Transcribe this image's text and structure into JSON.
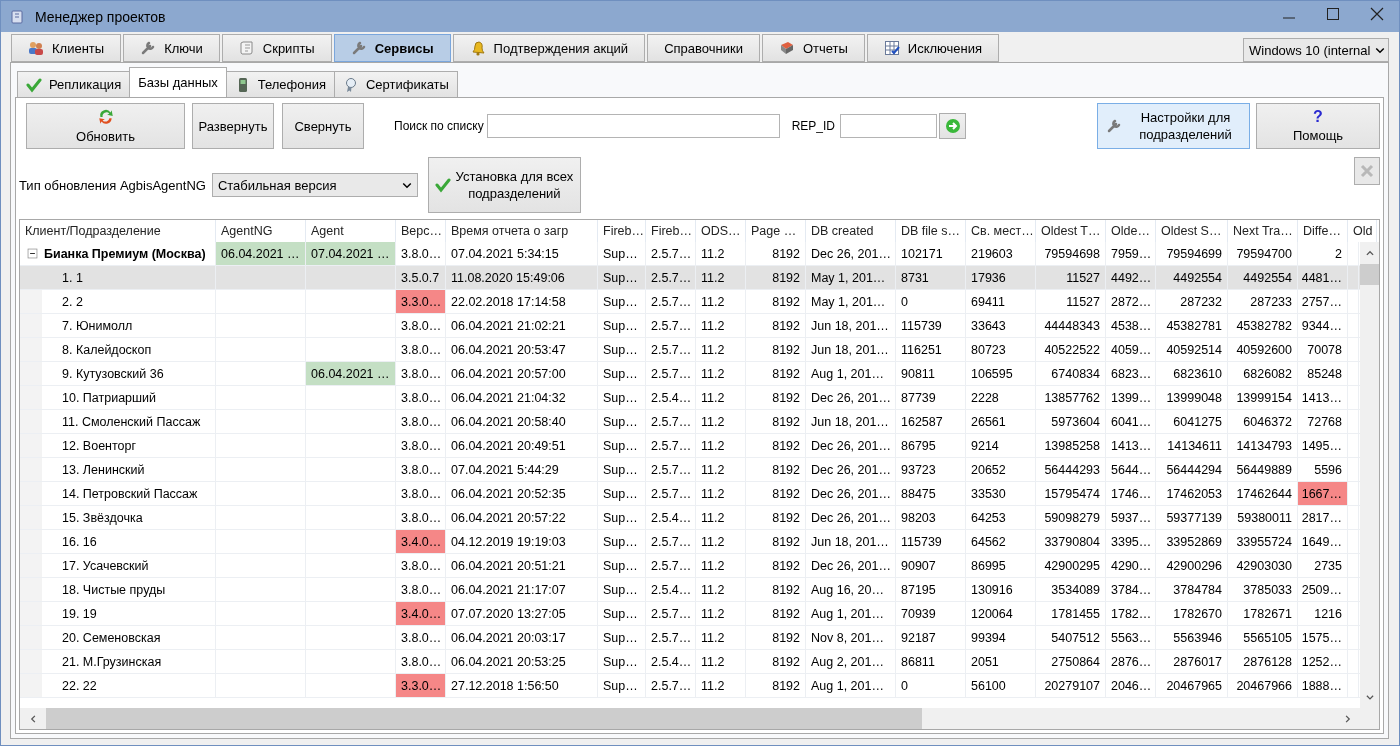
{
  "window": {
    "title": "Менеджер проектов"
  },
  "tabs": [
    {
      "label": "Клиенты",
      "selected": false
    },
    {
      "label": "Ключи",
      "selected": false
    },
    {
      "label": "Скрипты",
      "selected": false
    },
    {
      "label": "Сервисы",
      "selected": true
    },
    {
      "label": "Подтверждения акций",
      "selected": false
    },
    {
      "label": "Справочники",
      "selected": false
    },
    {
      "label": "Отчеты",
      "selected": false
    },
    {
      "label": "Исключения",
      "selected": false
    }
  ],
  "system_select": {
    "value": "Windows 10 (internal"
  },
  "subtabs": [
    {
      "label": "Репликация",
      "selected": false
    },
    {
      "label": "Базы данных",
      "selected": true
    },
    {
      "label": "Телефония",
      "selected": false
    },
    {
      "label": "Сертификаты",
      "selected": false
    }
  ],
  "toolbar": {
    "refresh": "Обновить",
    "expand": "Развернуть",
    "collapse": "Свернуть",
    "search_label": "Поиск по списку",
    "rep_id_label": "REP_ID",
    "settings": "Настройки для подразделений",
    "help": {
      "icon": "?",
      "label": "Помощь"
    },
    "clear_button": {
      "disabled": true
    }
  },
  "update": {
    "label": "Тип обновления AgbisAgentNG",
    "value": "Стабильная версия",
    "install_button": "Установка для всех подразделений"
  },
  "grid": {
    "columns": [
      "Клиент/Подразделение",
      "AgentNG",
      "Agent",
      "Верс…",
      "Время отчета о загр",
      "Fireb…",
      "Fireb…",
      "ODS…",
      "Page …",
      "DB created",
      "DB file s…",
      "Св. мест…",
      "Oldest T…",
      "Olde…",
      "Oldest S…",
      "Next Tra…",
      "Diffe…",
      "Old"
    ],
    "rows": [
      {
        "selected": false,
        "expanded": true,
        "cells": [
          "Бианка Премиум (Москва)",
          {
            "text": "06.04.2021 …",
            "color": "#c4dfc4"
          },
          {
            "text": "07.04.2021 …",
            "color": "#c4dfc4"
          },
          "3.8.0…",
          "07.04.2021 5:34:15",
          "Sup…",
          "2.5.7…",
          "11.2",
          "8192",
          "Dec 26, 201…",
          "102171",
          "219603",
          "79594698",
          "7959…",
          "79594699",
          "79594700",
          "2",
          ""
        ],
        "children": [
          {
            "selected": true,
            "cells": [
              "1. 1",
              "",
              "",
              "3.5.0.7",
              "11.08.2020 15:49:06",
              "Sup…",
              "2.5.7…",
              "11.2",
              "8192",
              "May 1, 201…",
              "8731",
              "17936",
              "11527",
              "4492…",
              "4492554",
              "4492554",
              "4481…",
              ""
            ]
          },
          {
            "selected": false,
            "cells": [
              "2. 2",
              "",
              "",
              {
                "text": "3.3.0…",
                "color": "#f58787"
              },
              "22.02.2018 17:14:58",
              "Sup…",
              "2.5.7…",
              "11.2",
              "8192",
              "May 1, 201…",
              "0",
              "69411",
              "11527",
              "2872…",
              "287232",
              "287233",
              "2757…",
              ""
            ]
          },
          {
            "selected": false,
            "cells": [
              "7. Юнимолл",
              "",
              "",
              "3.8.0…",
              "06.04.2021 21:02:21",
              "Sup…",
              "2.5.7…",
              "11.2",
              "8192",
              "Jun 18, 201…",
              "115739",
              "33643",
              "44448343",
              "4538…",
              "45382781",
              "45382782",
              "9344…",
              ""
            ]
          },
          {
            "selected": false,
            "cells": [
              "8. Калейдоскоп",
              "",
              "",
              "3.8.0…",
              "06.04.2021 20:53:47",
              "Sup…",
              "2.5.7…",
              "11.2",
              "8192",
              "Jun 18, 201…",
              "116251",
              "80723",
              "40522522",
              "4059…",
              "40592514",
              "40592600",
              "70078",
              ""
            ]
          },
          {
            "selected": false,
            "cells": [
              "9. Кутузовский 36",
              "",
              {
                "text": "06.04.2021 …",
                "color": "#c4dfc4"
              },
              "3.8.0…",
              "06.04.2021 20:57:00",
              "Sup…",
              "2.5.7…",
              "11.2",
              "8192",
              "Aug 1, 201…",
              "90811",
              "106595",
              "6740834",
              "6823…",
              "6823610",
              "6826082",
              "85248",
              ""
            ]
          },
          {
            "selected": false,
            "cells": [
              "10. Патриарший",
              "",
              "",
              "3.8.0…",
              "06.04.2021 21:04:32",
              "Sup…",
              "2.5.4…",
              "11.2",
              "8192",
              "Dec 26, 201…",
              "87739",
              "2228",
              "13857762",
              "1399…",
              "13999048",
              "13999154",
              "1413…",
              ""
            ]
          },
          {
            "selected": false,
            "cells": [
              "11. Смоленский Пассаж",
              "",
              "",
              "3.8.0…",
              "06.04.2021 20:58:40",
              "Sup…",
              "2.5.7…",
              "11.2",
              "8192",
              "Jun 18, 201…",
              "162587",
              "26561",
              "5973604",
              "6041…",
              "6041275",
              "6046372",
              "72768",
              ""
            ]
          },
          {
            "selected": false,
            "cells": [
              "12. Военторг",
              "",
              "",
              "3.8.0…",
              "06.04.2021 20:49:51",
              "Sup…",
              "2.5.7…",
              "11.2",
              "8192",
              "Dec 26, 201…",
              "86795",
              "9214",
              "13985258",
              "1413…",
              "14134611",
              "14134793",
              "1495…",
              ""
            ]
          },
          {
            "selected": false,
            "cells": [
              "13. Ленинский",
              "",
              "",
              "3.8.0…",
              "07.04.2021 5:44:29",
              "Sup…",
              "2.5.7…",
              "11.2",
              "8192",
              "Dec 26, 201…",
              "93723",
              "20652",
              "56444293",
              "5644…",
              "56444294",
              "56449889",
              "5596",
              ""
            ]
          },
          {
            "selected": false,
            "cells": [
              "14. Петровский Пассаж",
              "",
              "",
              "3.8.0…",
              "06.04.2021 20:52:35",
              "Sup…",
              "2.5.7…",
              "11.2",
              "8192",
              "Dec 26, 201…",
              "88475",
              "33530",
              "15795474",
              "1746…",
              "17462053",
              "17462644",
              {
                "text": "1667…",
                "color": "#f58787"
              },
              ""
            ]
          },
          {
            "selected": false,
            "cells": [
              "15. Звёздочка",
              "",
              "",
              "3.8.0…",
              "06.04.2021 20:57:22",
              "Sup…",
              "2.5.4…",
              "11.2",
              "8192",
              "Dec 26, 201…",
              "98203",
              "64253",
              "59098279",
              "5937…",
              "59377139",
              "59380011",
              "2817…",
              ""
            ]
          },
          {
            "selected": false,
            "cells": [
              "16. 16",
              "",
              "",
              {
                "text": "3.4.0…",
                "color": "#f58787"
              },
              "04.12.2019 19:19:03",
              "Sup…",
              "2.5.7…",
              "11.2",
              "8192",
              "Jun 18, 201…",
              "115739",
              "64562",
              "33790804",
              "3395…",
              "33952869",
              "33955724",
              "1649…",
              ""
            ]
          },
          {
            "selected": false,
            "cells": [
              "17. Усачевский",
              "",
              "",
              "3.8.0…",
              "06.04.2021 20:51:21",
              "Sup…",
              "2.5.7…",
              "11.2",
              "8192",
              "Dec 26, 201…",
              "90907",
              "86995",
              "42900295",
              "4290…",
              "42900296",
              "42903030",
              "2735",
              ""
            ]
          },
          {
            "selected": false,
            "cells": [
              "18. Чистые пруды",
              "",
              "",
              "3.8.0…",
              "06.04.2021 21:17:07",
              "Sup…",
              "2.5.4…",
              "11.2",
              "8192",
              "Aug 16, 20…",
              "87195",
              "130916",
              "3534089",
              "3784…",
              "3784784",
              "3785033",
              "2509…",
              ""
            ]
          },
          {
            "selected": false,
            "cells": [
              "19. 19",
              "",
              "",
              {
                "text": "3.4.0…",
                "color": "#f58787"
              },
              "07.07.2020 13:27:05",
              "Sup…",
              "2.5.7…",
              "11.2",
              "8192",
              "Aug 1, 201…",
              "70939",
              "120064",
              "1781455",
              "1782…",
              "1782670",
              "1782671",
              "1216",
              ""
            ]
          },
          {
            "selected": false,
            "cells": [
              "20. Семеновская",
              "",
              "",
              "3.8.0…",
              "06.04.2021 20:03:17",
              "Sup…",
              "2.5.7…",
              "11.2",
              "8192",
              "Nov 8, 201…",
              "92187",
              "99394",
              "5407512",
              "5563…",
              "5563946",
              "5565105",
              "1575…",
              ""
            ]
          },
          {
            "selected": false,
            "cells": [
              "21. М.Грузинская",
              "",
              "",
              "3.8.0…",
              "06.04.2021 20:53:25",
              "Sup…",
              "2.5.4…",
              "11.2",
              "8192",
              "Aug 2, 201…",
              "86811",
              "2051",
              "2750864",
              "2876…",
              "2876017",
              "2876128",
              "1252…",
              ""
            ]
          },
          {
            "selected": false,
            "cells": [
              "22. 22",
              "",
              "",
              {
                "text": "3.3.0…",
                "color": "#f58787"
              },
              "27.12.2018 1:56:50",
              "Sup…",
              "2.5.7…",
              "11.2",
              "8192",
              "Aug 1, 201…",
              "0",
              "56100",
              "20279107",
              "2046…",
              "20467965",
              "20467966",
              "1888…",
              ""
            ]
          }
        ]
      }
    ]
  }
}
